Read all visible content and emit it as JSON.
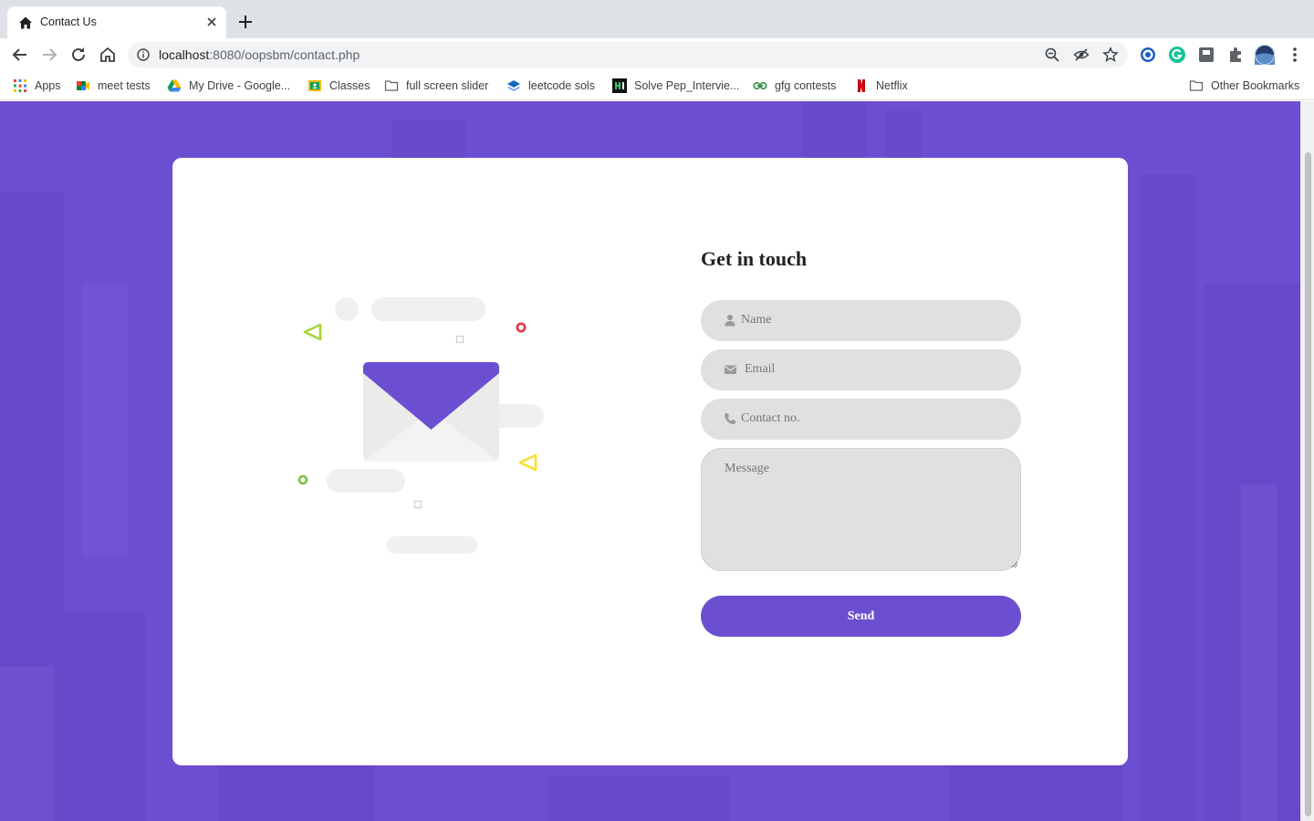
{
  "browser": {
    "tab_title": "Contact Us",
    "url_host": "localhost",
    "url_rest": ":8080/oopsbm/contact.php",
    "bookmarks": [
      {
        "label": "Apps",
        "icon": "apps-grid-icon"
      },
      {
        "label": "meet tests",
        "icon": "google-meet-icon"
      },
      {
        "label": "My Drive - Google...",
        "icon": "google-drive-icon"
      },
      {
        "label": "Classes",
        "icon": "google-classroom-icon"
      },
      {
        "label": "full screen slider",
        "icon": "folder-icon"
      },
      {
        "label": "leetcode sols",
        "icon": "layers-icon"
      },
      {
        "label": "Solve Pep_Intervie...",
        "icon": "hackerrank-icon"
      },
      {
        "label": "gfg contests",
        "icon": "gfg-icon"
      },
      {
        "label": "Netflix",
        "icon": "netflix-icon"
      }
    ],
    "other_bookmarks": "Other Bookmarks"
  },
  "form": {
    "title": "Get in touch",
    "name_placeholder": "Name",
    "email_placeholder": "Email",
    "contact_placeholder": "Contact no.",
    "message_placeholder": "Message",
    "send_label": "Send"
  },
  "colors": {
    "accent": "#6c4ed0",
    "field_bg": "#e0e0e0",
    "triangle_green": "#a6d43a",
    "triangle_yellow": "#f5e12c",
    "circle_red": "#e8334a",
    "circle_green": "#7cc243"
  }
}
